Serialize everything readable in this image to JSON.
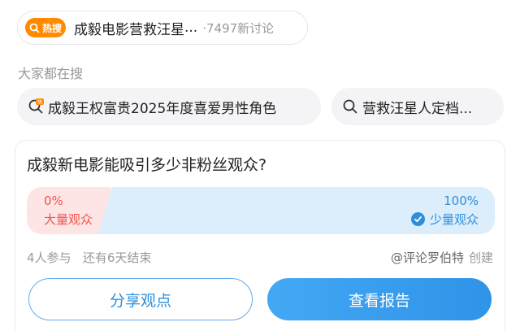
{
  "hot_search": {
    "badge_label": "热搜",
    "title": "成毅电影营救汪星",
    "ellipsis": "...",
    "discussion_count": "·7497新讨论"
  },
  "section_label": "大家都在搜",
  "suggestions": [
    {
      "text": "成毅王权富贵2025年度喜爱男性角色",
      "icon": "hot-search-icon"
    },
    {
      "text": "营救汪星人定档...",
      "icon": "search-icon"
    }
  ],
  "poll": {
    "question": "成毅新电影能吸引多少非粉丝观众?",
    "options": [
      {
        "percent": "0%",
        "label": "大量观众",
        "fraction": 0.0,
        "color": "#f0534b"
      },
      {
        "percent": "100%",
        "label": "少量观众",
        "fraction": 1.0,
        "color": "#2d8fdc",
        "selected": true
      }
    ],
    "meta": "4人参与   还有6天结束",
    "creator": "@评论罗伯特",
    "creator_suffix": "创建",
    "share_button": "分享观点",
    "report_button": "查看报告"
  },
  "colors": {
    "hot_badge": "#ff8a00",
    "accent_blue": "#2d8fdc",
    "accent_red": "#f0534b"
  }
}
